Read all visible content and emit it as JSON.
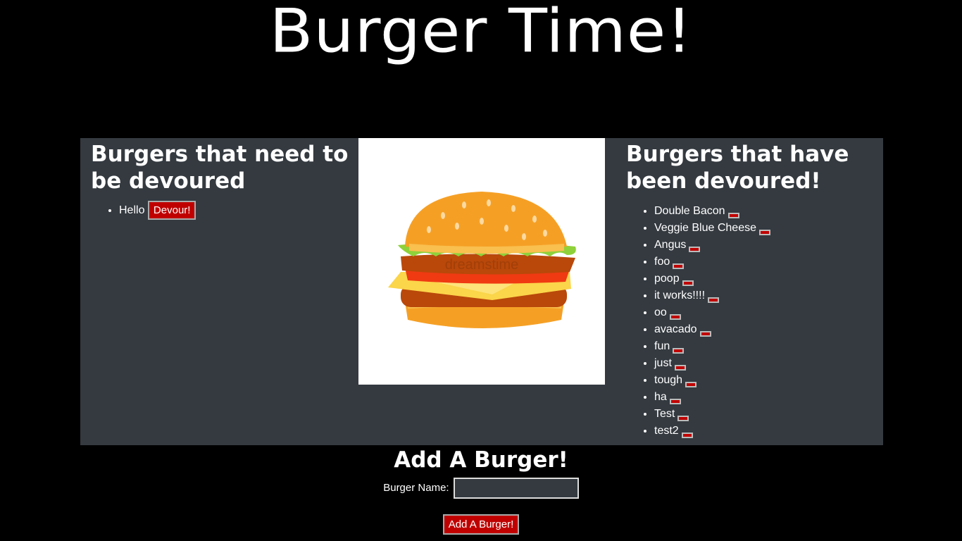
{
  "page": {
    "title": "Burger Time!"
  },
  "left": {
    "heading": "Burgers that need to be devoured",
    "items": [
      {
        "name": "Hello",
        "button_label": "Devour!"
      }
    ]
  },
  "image": {
    "watermark": "dreamstime"
  },
  "right": {
    "heading": "Burgers that have been devoured!",
    "items": [
      "Double Bacon",
      "Veggie Blue Cheese",
      "Angus",
      "foo",
      "poop",
      "it works!!!!",
      "oo",
      "avacado",
      "fun",
      "just",
      "tough",
      "ha",
      "Test",
      "test2"
    ]
  },
  "form": {
    "title": "Add A Burger!",
    "label": "Burger Name:",
    "input_value": "",
    "submit_label": "Add A Burger!"
  },
  "colors": {
    "panel": "#343a40",
    "button": "#c00000",
    "background": "#000000"
  }
}
